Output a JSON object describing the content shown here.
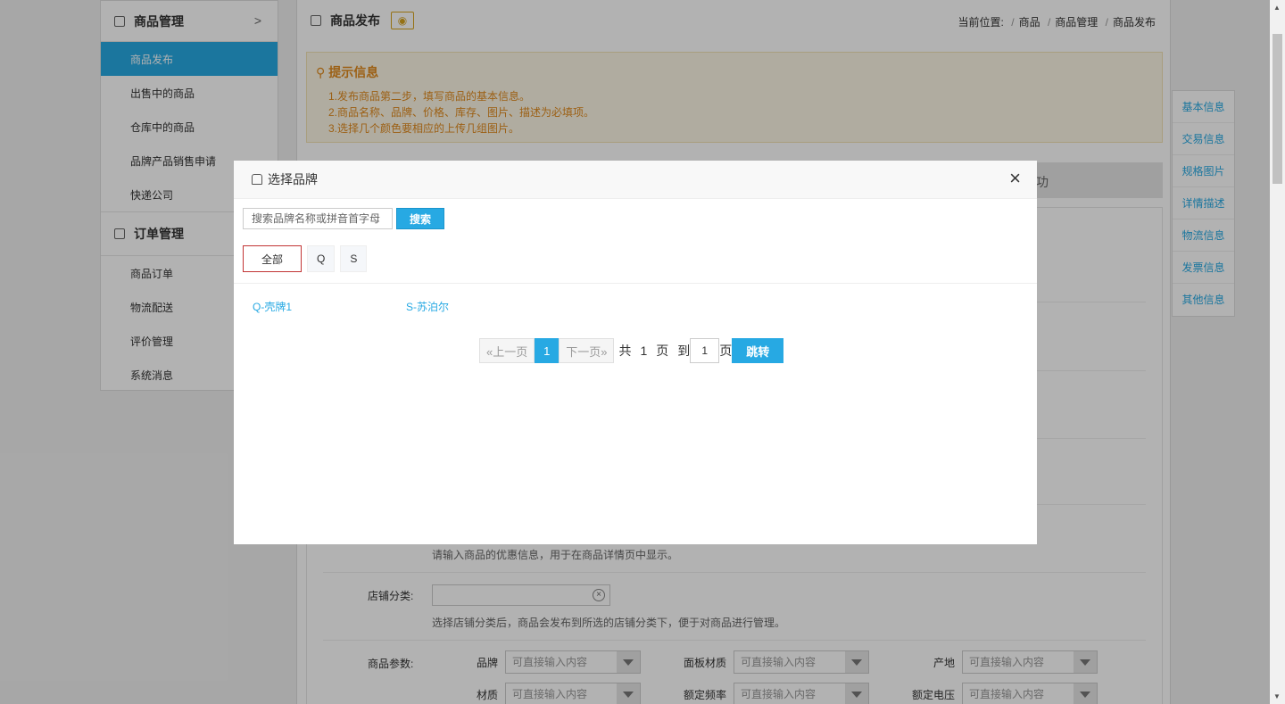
{
  "sidebar": {
    "group1_title": "商品管理",
    "group1_items": [
      "商品发布",
      "出售中的商品",
      "仓库中的商品",
      "品牌产品销售申请",
      "快递公司"
    ],
    "group2_title": "订单管理",
    "group2_items": [
      "商品订单",
      "物流配送",
      "评价管理",
      "系统消息"
    ]
  },
  "header": {
    "title": "商品发布",
    "breadcrumb_prefix": "当前位置:",
    "breadcrumb": [
      "商品",
      "商品管理",
      "商品发布"
    ]
  },
  "tips": {
    "title": "提示信息",
    "lines": [
      "1.发布商品第二步，填写商品的基本信息。",
      "2.商品名称、品牌、价格、库存、图片、描述为必填项。",
      "3.选择几个颜色要相应的上传几组图片。"
    ]
  },
  "stepbar_tail": "功",
  "form": {
    "promo_hint": "请输入商品的优惠信息，用于在商品详情页中显示。",
    "shop_category_label": "店铺分类:",
    "shop_category_hint": "选择店铺分类后，商品会发布到所选的店铺分类下，便于对商品进行管理。",
    "params_label": "商品参数:",
    "params": [
      {
        "label": "品牌",
        "placeholder": "可直接输入内容"
      },
      {
        "label": "面板材质",
        "placeholder": "可直接输入内容"
      },
      {
        "label": "产地",
        "placeholder": "可直接输入内容"
      },
      {
        "label": "材质",
        "placeholder": "可直接输入内容"
      },
      {
        "label": "额定频率",
        "placeholder": "可直接输入内容"
      },
      {
        "label": "额定电压",
        "placeholder": "可直接输入内容"
      }
    ]
  },
  "right_nav": [
    "基本信息",
    "交易信息",
    "规格图片",
    "详情描述",
    "物流信息",
    "发票信息",
    "其他信息"
  ],
  "modal": {
    "title": "选择品牌",
    "close": "×",
    "search_placeholder": "搜索品牌名称或拼音首字母",
    "search_button": "搜索",
    "letters": [
      "全部",
      "Q",
      "S"
    ],
    "brands": [
      "Q-壳牌1",
      "S-苏泊尔"
    ],
    "pager": {
      "prev": "«上一页",
      "current": "1",
      "next": "下一页»",
      "total_prefix": "共",
      "total_pages": "1",
      "total_suffix": "页",
      "goto_prefix": "到",
      "goto_value": "1",
      "goto_suffix": "页",
      "go_button": "跳转"
    }
  }
}
